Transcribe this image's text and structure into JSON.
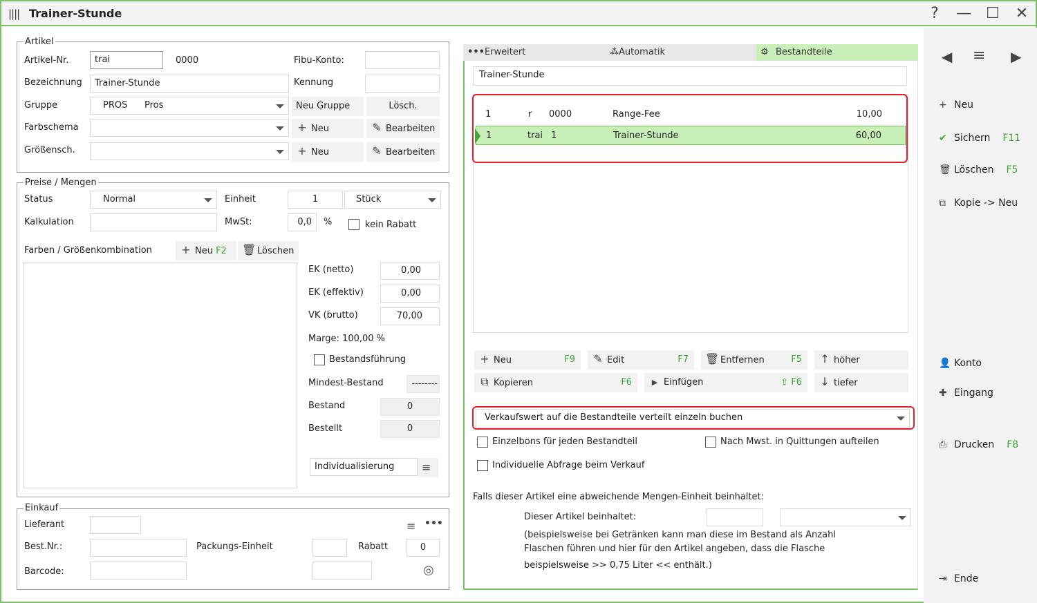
{
  "window": {
    "title": "Trainer-Stunde",
    "help": "?",
    "minimize": "—",
    "maximize": "☐",
    "close": "✕"
  },
  "artikel": {
    "legend": "Artikel",
    "artikel_nr_label": "Artikel-Nr.",
    "artikel_nr_value": "trai",
    "artikel_nr_code": "0000",
    "fibu_label": "Fibu-Konto:",
    "fibu_value": "",
    "bezeichnung_label": "Bezeichnung",
    "bezeichnung_value": "Trainer-Stunde",
    "kennung_label": "Kennung",
    "kennung_value": "",
    "gruppe_label": "Gruppe",
    "gruppe_code": "PROS",
    "gruppe_name": "Pros",
    "neu_gruppe": "Neu Gruppe",
    "losch": "Lösch.",
    "farbschema_label": "Farbschema",
    "groessensch_label": "Größensch.",
    "neu": "Neu",
    "bearbeiten": "Bearbeiten"
  },
  "preise": {
    "legend": "Preise / Mengen",
    "status_label": "Status",
    "status_value": "Normal",
    "einheit_label": "Einheit",
    "einheit_value": "1",
    "einheit_unit": "Stück",
    "kalkulation_label": "Kalkulation",
    "mwst_label": "MwSt:",
    "mwst_value": "0,0",
    "percent": "%",
    "kein_rabatt": "kein Rabatt",
    "farben_label": "Farben / Größenkombination",
    "neu": "Neu",
    "neu_key": "F2",
    "loeschen": "Löschen",
    "ek_netto_label": "EK (netto)",
    "ek_netto": "0,00",
    "ek_eff_label": "EK (effektiv)",
    "ek_eff": "0,00",
    "vk_label": "VK (brutto)",
    "vk": "70,00",
    "marge": "Marge: 100,00 %",
    "bestandsfuehrung": "Bestandsführung",
    "mindest_label": "Mindest-Bestand",
    "mindest_value": "--------",
    "bestand_label": "Bestand",
    "bestand_value": "0",
    "bestellt_label": "Bestellt",
    "bestellt_value": "0",
    "individualisierung": "Individualisierung"
  },
  "einkauf": {
    "legend": "Einkauf",
    "lieferant_label": "Lieferant",
    "bestnr_label": "Best.Nr.:",
    "packung_label": "Packungs-Einheit",
    "rabatt_label": "Rabatt",
    "rabatt_value": "0",
    "barcode_label": "Barcode:"
  },
  "tabs": {
    "erweitert": "Erweitert",
    "automatik": "Automatik",
    "bestandteile": "Bestandteile"
  },
  "bestandteile": {
    "name": "Trainer-Stunde",
    "rows": [
      {
        "qty": "1",
        "code": "r",
        "nr": "0000",
        "name": "Range-Fee",
        "price": "10,00"
      },
      {
        "qty": "1",
        "code": "trai",
        "nr": "1",
        "name": "Trainer-Stunde",
        "price": "60,00"
      }
    ],
    "buttons": {
      "neu": "Neu",
      "neu_key": "F9",
      "edit": "Edit",
      "edit_key": "F7",
      "entfernen": "Entfernen",
      "entfernen_key": "F5",
      "hoeher": "höher",
      "kopieren": "Kopieren",
      "kopieren_key": "F6",
      "einfuegen": "Einfügen",
      "einfuegen_key": "F6",
      "tiefer": "tiefer"
    },
    "buchung": "Verkaufswert auf die Bestandteile verteilt einzeln buchen",
    "einzelbons": "Einzelbons für jeden Bestandteil",
    "nach_mwst": "Nach Mwst. in Quittungen aufteilen",
    "individuelle": "Individuelle Abfrage beim Verkauf",
    "falls": "Falls dieser Artikel eine abweichende Mengen-Einheit beinhaltet:",
    "dieser": "Dieser Artikel beinhaltet:",
    "hint1": "(beispielsweise bei Getränken kann man diese im Bestand als Anzahl",
    "hint2": "Flaschen führen und hier für den Artikel angeben, dass die Flasche",
    "hint3": "beispielsweise >> 0,75 Liter << enthält.)"
  },
  "sidebar": {
    "neu": "Neu",
    "sichern": "Sichern",
    "sichern_key": "F11",
    "loeschen": "Löschen",
    "loeschen_key": "F5",
    "kopie": "Kopie -> Neu",
    "konto": "Konto",
    "eingang": "Eingang",
    "drucken": "Drucken",
    "drucken_key": "F8",
    "ende": "Ende"
  },
  "colors": {
    "accent": "#7cc168",
    "key": "#3fa63a",
    "selected_row": "#c9efb9",
    "highlight": "#e0202a"
  }
}
